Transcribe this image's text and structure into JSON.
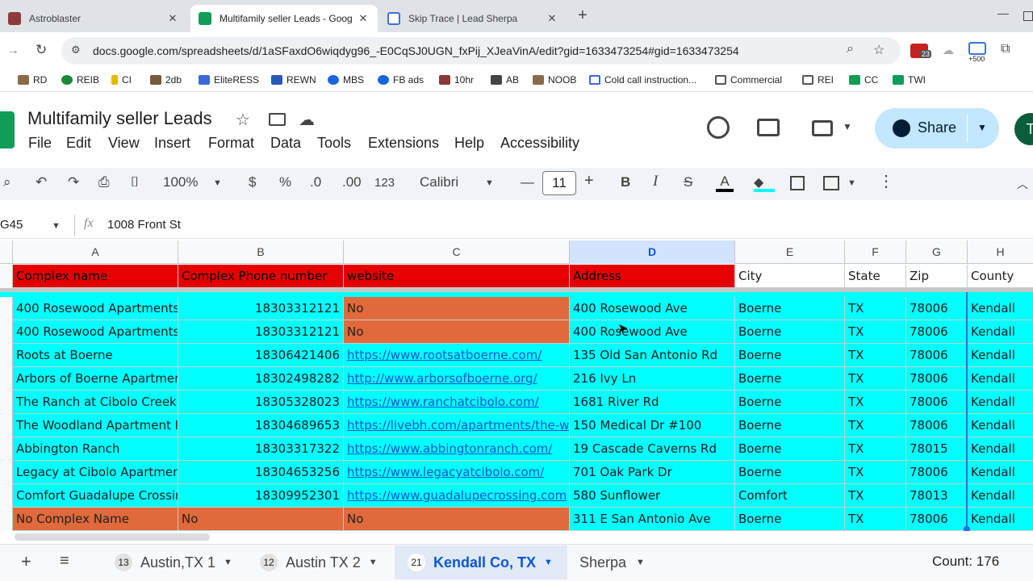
{
  "browser": {
    "tabs": [
      {
        "title": "Astroblaster",
        "color": "#8e3b3b"
      },
      {
        "title": "Multifamily seller Leads - Goog",
        "color": "#0f9d58"
      },
      {
        "title": "Skip Trace | Lead Sherpa",
        "color": "#3d6fd8"
      }
    ],
    "url": "docs.google.com/spreadsheets/d/1aSFaxdO6wiqdyg96_-E0CqSJ0UGN_fxPij_XJeaVinA/edit?gid=1633473254#gid=1633473254",
    "ext_badges": [
      "23",
      "+500"
    ],
    "bookmarks": [
      "RD",
      "REIB",
      "CI",
      "2db",
      "EliteRESS",
      "REWN",
      "MBS",
      "FB ads",
      "10hr",
      "AB",
      "NOOB",
      "Cold call instruction...",
      "Commercial",
      "REI",
      "CC",
      "TWI"
    ]
  },
  "sheet": {
    "title": "Multifamily seller Leads",
    "menu": [
      "File",
      "Edit",
      "View",
      "Insert",
      "Format",
      "Data",
      "Tools",
      "Extensions",
      "Help",
      "Accessibility"
    ],
    "share_label": "Share",
    "avatar_letter": "T",
    "toolbar": {
      "zoom": "100%",
      "currency": "$",
      "percent": "%",
      "dec_less": ".0",
      "dec_more": ".00",
      "number_format": "123",
      "font": "Calibri",
      "font_size": "11",
      "bold": "B",
      "italic": "I",
      "strike": "S",
      "text_color": "A"
    },
    "name_box": "G45",
    "fx": "fx",
    "formula": "1008 Front St",
    "columns": [
      "A",
      "B",
      "C",
      "D",
      "E",
      "F",
      "G",
      "H"
    ],
    "selected_column": "D",
    "header_row": [
      "Complex name",
      "Complex Phone number",
      "website",
      "Address",
      "City",
      "State",
      "Zip",
      "County"
    ],
    "rows": [
      [
        "400 Rosewood Apartments",
        "18303312121",
        "No",
        "400 Rosewood Ave",
        "Boerne",
        "TX",
        "78006",
        "Kendall"
      ],
      [
        "400 Rosewood Apartments",
        "18303312121",
        "No",
        "400 Rosewood Ave",
        "Boerne",
        "TX",
        "78006",
        "Kendall"
      ],
      [
        "Roots at Boerne",
        "18306421406",
        "https://www.rootsatboerne.com/",
        "135 Old San Antonio Rd",
        "Boerne",
        "TX",
        "78006",
        "Kendall"
      ],
      [
        "Arbors of Boerne Apartmer",
        "18302498282",
        "http://www.arborsofboerne.org/",
        "216 Ivy Ln",
        "Boerne",
        "TX",
        "78006",
        "Kendall"
      ],
      [
        "The Ranch at Cibolo Creek",
        "18305328023",
        "https://www.ranchatcibolo.com/",
        "1681 River Rd",
        "Boerne",
        "TX",
        "78006",
        "Kendall"
      ],
      [
        "The Woodland Apartment I",
        "18304689653",
        "https://livebh.com/apartments/the-w",
        "150 Medical Dr #100",
        "Boerne",
        "TX",
        "78006",
        "Kendall"
      ],
      [
        "Abbington Ranch",
        "18303317322",
        "https://www.abbingtonranch.com/",
        "19 Cascade Caverns Rd",
        "Boerne",
        "TX",
        "78015",
        "Kendall"
      ],
      [
        "Legacy at Cibolo Apartmen",
        "18304653256",
        "https://www.legacyatcibolo.com/",
        "701 Oak Park Dr",
        "Boerne",
        "TX",
        "78006",
        "Kendall"
      ],
      [
        "Comfort Guadalupe Crossir",
        "18309952301",
        "https://www.guadalupecrossing.com",
        "580 Sunflower",
        "Comfort",
        "TX",
        "78013",
        "Kendall"
      ],
      [
        "No Complex Name",
        "No",
        "No",
        "311 E San Antonio Ave",
        "Boerne",
        "TX",
        "78006",
        "Kendall"
      ]
    ],
    "sheet_tabs": [
      {
        "badge": "13",
        "label": "Austin,TX 1"
      },
      {
        "badge": "12",
        "label": "Austin TX 2"
      },
      {
        "badge": "21",
        "label": "Kendall Co, TX"
      },
      {
        "badge": "",
        "label": "Sherpa"
      }
    ],
    "count_label": "Count: 176"
  },
  "colors": {
    "header_red": "#e70000",
    "cyan": "#00ffff",
    "orange": "#e06a3c",
    "selected_col": "#d3e3fd",
    "share_bg": "#c2e7ff"
  }
}
